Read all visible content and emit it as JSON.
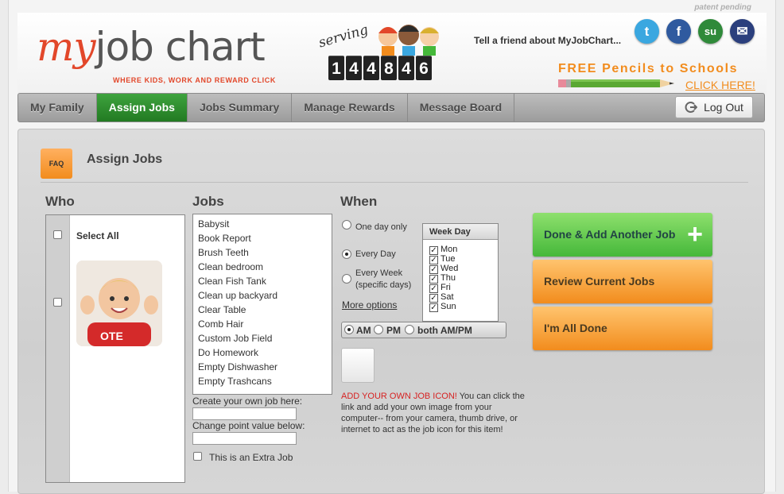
{
  "patent": "patent pending",
  "logo": {
    "my": "my",
    "job_chart": "job chart",
    "tagline": "WHERE KIDS, WORK AND REWARD CLICK"
  },
  "counter": {
    "serving": "serving",
    "digits": [
      "1",
      "4",
      "4",
      "8",
      "4",
      "6"
    ]
  },
  "tell_friend": "Tell a friend about MyJobChart...",
  "social": [
    {
      "icon": "twitter-icon",
      "glyph": "t",
      "color": "#3aa7e0"
    },
    {
      "icon": "facebook-icon",
      "glyph": "f",
      "color": "#2f5a9f"
    },
    {
      "icon": "stumbleupon-icon",
      "glyph": "su",
      "color": "#2f8a3a"
    },
    {
      "icon": "email-icon",
      "glyph": "✉",
      "color": "#2b3f7d"
    }
  ],
  "promo": {
    "text": "FREE Pencils to Schools",
    "link": "CLICK HERE!"
  },
  "nav": {
    "tabs": [
      "My Family",
      "Assign Jobs",
      "Jobs Summary",
      "Manage Rewards",
      "Message Board"
    ],
    "active": "Assign Jobs",
    "logout": "Log Out"
  },
  "panel": {
    "faq": "FAQ",
    "title": "Assign Jobs",
    "who_header": "Who",
    "jobs_header": "Jobs",
    "when_header": "When",
    "select_all": "Select All",
    "jobs": [
      "Babysit",
      "Book Report",
      "Brush Teeth",
      "Clean bedroom",
      "Clean Fish Tank",
      "Clean up backyard",
      "Clear Table",
      "Comb Hair",
      "Custom Job Field",
      "Do Homework",
      "Empty Dishwasher",
      "Empty Trashcans"
    ],
    "create_label": "Create your own job here:",
    "point_label": "Change point value below:",
    "extra_job": "This is an Extra Job",
    "when": {
      "one_day": "One day only",
      "every_day": "Every Day",
      "every_week": "Every Week",
      "specific_days": "(specific days)",
      "more_options": "More options",
      "weekday_header": "Week Day",
      "days": [
        "Mon",
        "Tue",
        "Wed",
        "Thu",
        "Fri",
        "Sat",
        "Sun"
      ],
      "am": "AM",
      "pm": "PM",
      "both": "both AM/PM"
    },
    "add_icon_red": "ADD YOUR OWN JOB ICON!",
    "add_icon_text": " You can click the link and add your own image from your computer-- from your camera, thumb drive, or internet to act as the job icon for this item!",
    "buttons": {
      "done_add": "Done & Add Another Job",
      "review": "Review Current Jobs",
      "all_done": "I'm All Done"
    }
  }
}
